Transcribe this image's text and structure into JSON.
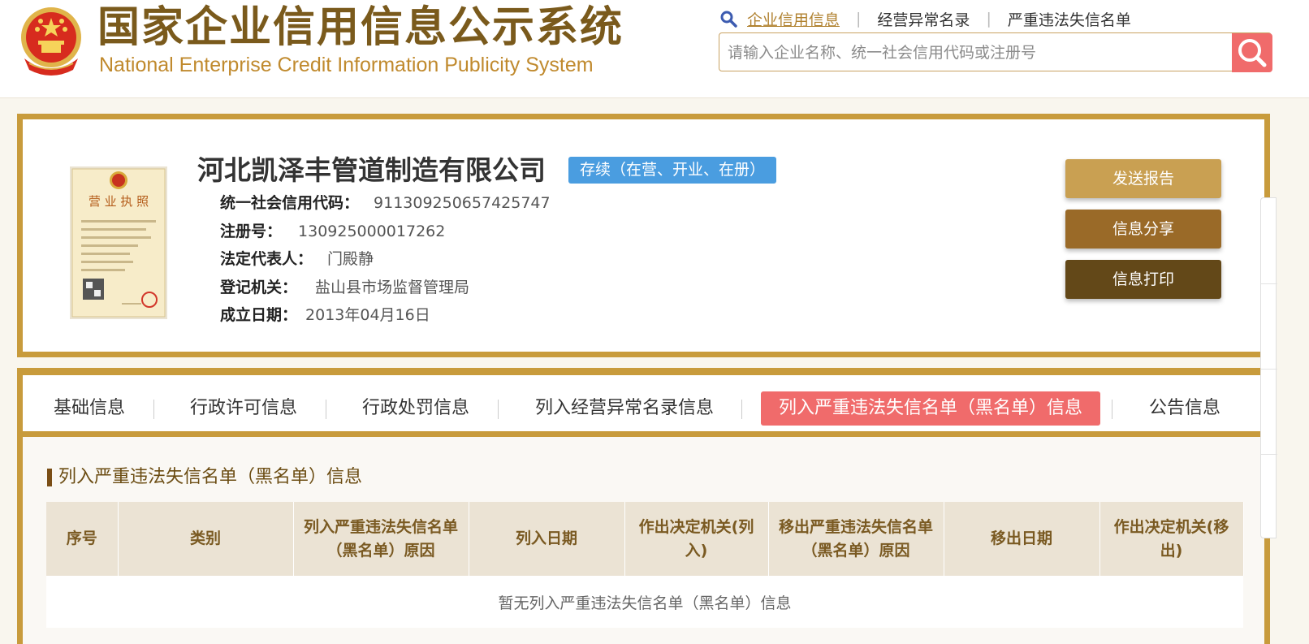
{
  "header": {
    "brand_cn": "国家企业信用信息公示系统",
    "brand_en": "National Enterprise Credit Information Publicity System",
    "links": [
      "企业信用信息",
      "经营异常名录",
      "严重违法失信名单"
    ],
    "search_placeholder": "请输入企业名称、统一社会信用代码或注册号"
  },
  "company": {
    "name": "河北凯泽丰管道制造有限公司",
    "status": "存续（在营、开业、在册）",
    "fields": [
      {
        "label": "统一社会信用代码：",
        "value": "911309250657425747"
      },
      {
        "label": "注册号：",
        "value": "130925000017262"
      },
      {
        "label": "法定代表人：",
        "value": "门殿静"
      },
      {
        "label": "登记机关：",
        "value": "盐山县市场监督管理局"
      },
      {
        "label": "成立日期：",
        "value": "2013年04月16日"
      }
    ],
    "license_title": "营 业 执 照"
  },
  "actions": {
    "send_report": "发送报告",
    "share": "信息分享",
    "print": "信息打印"
  },
  "tabs": [
    {
      "label": "基础信息"
    },
    {
      "label": "行政许可信息"
    },
    {
      "label": "行政处罚信息"
    },
    {
      "label": "列入经营异常名录信息"
    },
    {
      "label": "列入严重违法失信名单（黑名单）信息",
      "active": true
    },
    {
      "label": "公告信息"
    }
  ],
  "section": {
    "title": "列入严重违法失信名单（黑名单）信息",
    "columns": [
      "序号",
      "类别",
      "列入严重违法失信名单（黑名单）原因",
      "列入日期",
      "作出决定机关(列入)",
      "移出严重违法失信名单（黑名单）原因",
      "移出日期",
      "作出决定机关(移出)"
    ],
    "empty_text": "暂无列入严重违法失信名单（黑名单）信息"
  },
  "colors": {
    "gold_border": "#c89b3c",
    "brand": "#7a5a1c",
    "status_badge": "#4a9de0",
    "active_tab": "#f06b6b",
    "send_btn": "#c9a052",
    "share_btn": "#9a6a28",
    "print_btn": "#634818"
  },
  "icons": {
    "emblem": "national-emblem-icon",
    "link_search": "magnifier-icon",
    "search_button": "search-icon",
    "license": "business-license-image"
  }
}
